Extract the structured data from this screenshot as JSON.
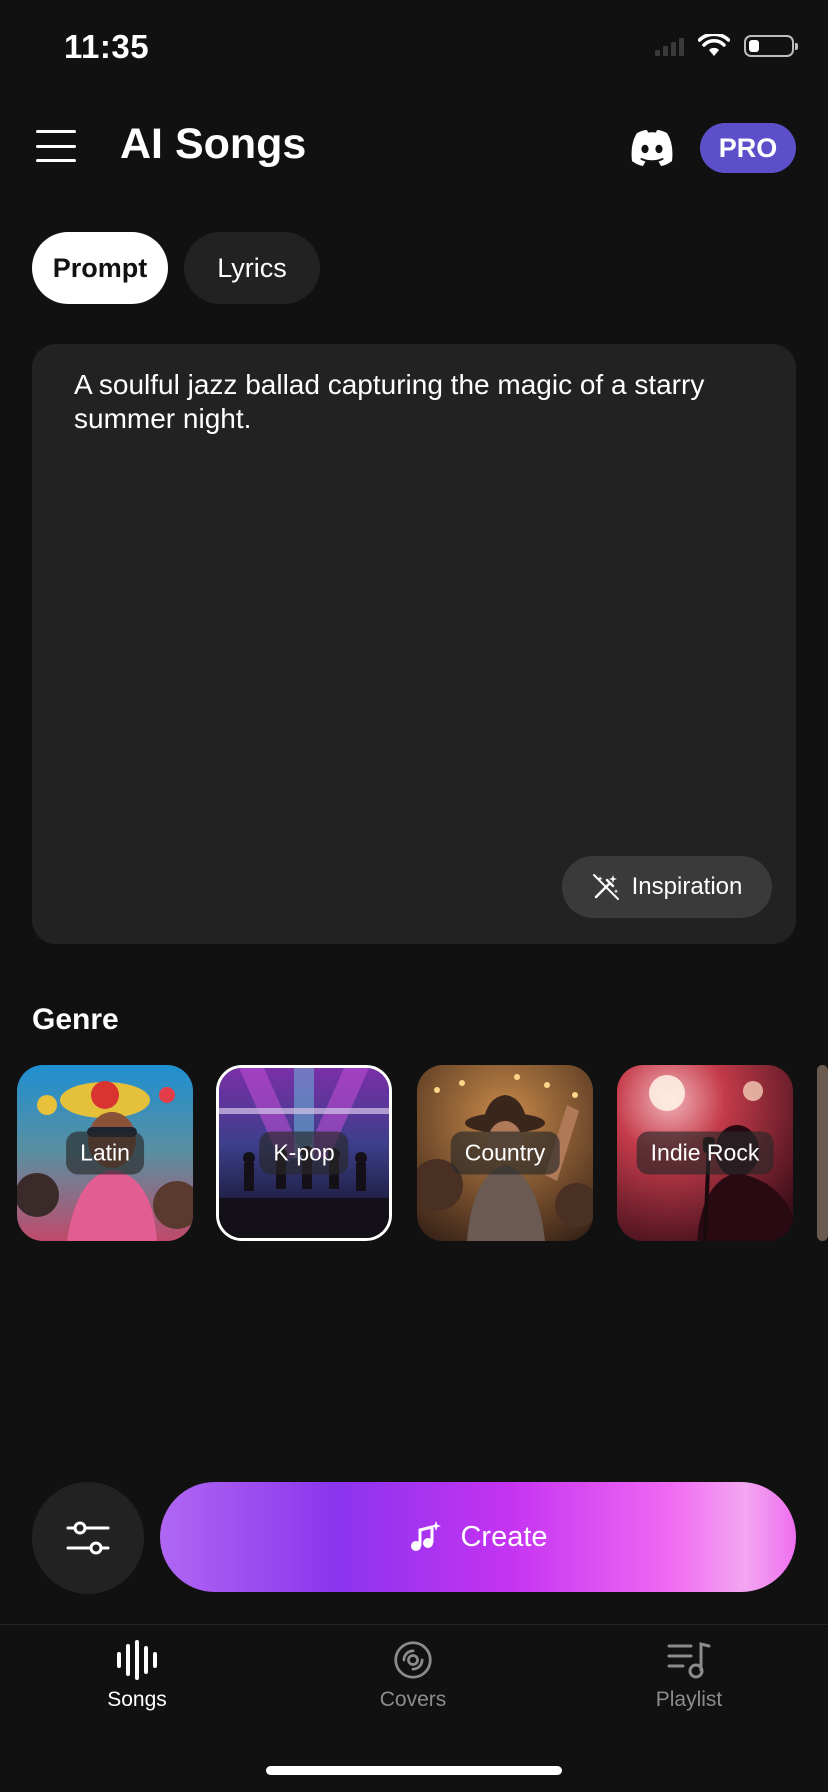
{
  "status_bar": {
    "time": "11:35"
  },
  "header": {
    "title": "AI Songs",
    "pro_label": "PRO"
  },
  "tabs": [
    {
      "label": "Prompt",
      "active": true
    },
    {
      "label": "Lyrics",
      "active": false
    }
  ],
  "prompt": {
    "text": "A soulful jazz ballad capturing the magic of a starry summer night.",
    "inspiration_label": "Inspiration"
  },
  "genre": {
    "title": "Genre",
    "items": [
      {
        "label": "Latin",
        "selected": false
      },
      {
        "label": "K-pop",
        "selected": true
      },
      {
        "label": "Country",
        "selected": false
      },
      {
        "label": "Indie Rock",
        "selected": false
      }
    ]
  },
  "actions": {
    "create_label": "Create"
  },
  "nav": [
    {
      "label": "Songs",
      "icon": "waveform-icon",
      "active": true
    },
    {
      "label": "Covers",
      "icon": "disc-icon",
      "active": false
    },
    {
      "label": "Playlist",
      "icon": "playlist-icon",
      "active": false
    }
  ],
  "colors": {
    "background": "#111111",
    "pro_badge": "#5d4fc9",
    "create_gradient": [
      "#b067f3",
      "#8b34ee",
      "#c533f2",
      "#f068f2",
      "#f3a6f1"
    ]
  }
}
